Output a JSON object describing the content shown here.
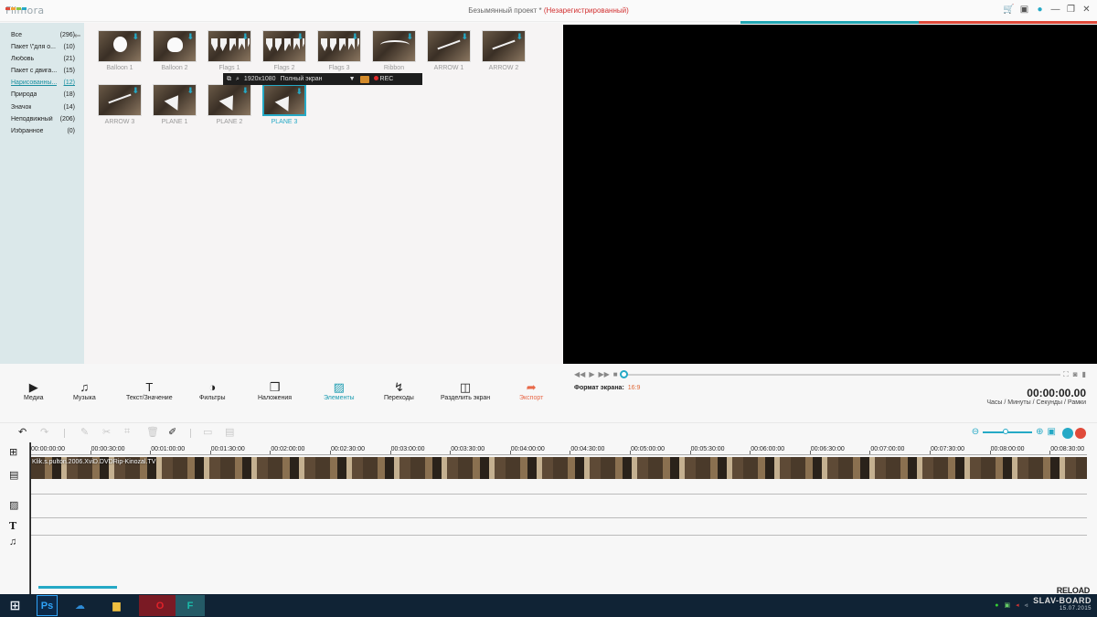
{
  "app": {
    "logo": "Filmora",
    "title": "Безымянный проект *",
    "title_status": "(Незарегистрированный)",
    "brand_colors": [
      "#e04a3a",
      "#f2a33a",
      "#8cc63f",
      "#25a9c6"
    ]
  },
  "title_icons": [
    {
      "name": "cart-icon",
      "glyph": "🛒"
    },
    {
      "name": "save-icon",
      "glyph": "▣"
    },
    {
      "name": "chat-icon",
      "glyph": "●"
    },
    {
      "name": "minimize-icon",
      "glyph": "—"
    },
    {
      "name": "restore-icon",
      "glyph": "❐"
    },
    {
      "name": "close-icon",
      "glyph": "✕"
    }
  ],
  "categories": [
    {
      "label": "Все",
      "count": "(296)"
    },
    {
      "label": "Пакет \\\"для о...",
      "count": "(10)"
    },
    {
      "label": "Любовь",
      "count": "(21)"
    },
    {
      "label": "Пакет с двига...",
      "count": "(15)"
    },
    {
      "label": "Нарисованны...",
      "count": "(12)",
      "active": true
    },
    {
      "label": "Природа",
      "count": "(18)"
    },
    {
      "label": "Значок",
      "count": "(14)"
    },
    {
      "label": "Неподвижный",
      "count": "(206)"
    },
    {
      "label": "Избранное",
      "count": "(0)"
    }
  ],
  "elements": [
    {
      "caption": "Balloon 1",
      "shape": "balloon"
    },
    {
      "caption": "Balloon 2",
      "shape": "heart"
    },
    {
      "caption": "Flags 1",
      "shape": "flags"
    },
    {
      "caption": "Flags 2",
      "shape": "flags"
    },
    {
      "caption": "Flags 3",
      "shape": "flags"
    },
    {
      "caption": "Ribbon",
      "shape": "ribbon"
    },
    {
      "caption": "ARROW 1",
      "shape": "arrow"
    },
    {
      "caption": "ARROW 2",
      "shape": "arrow"
    },
    {
      "caption": "ARROW 3",
      "shape": "arrow"
    },
    {
      "caption": "PLANE 1",
      "shape": "plane"
    },
    {
      "caption": "PLANE 2",
      "shape": "plane"
    },
    {
      "caption": "PLANE 3",
      "shape": "plane",
      "selected": true
    }
  ],
  "recorder": {
    "resolution": "1920x1080",
    "mode": "Полный экран",
    "rec_label": "REC"
  },
  "preview": {
    "format_label": "Формат экрана:",
    "format_value": "16:9",
    "timecode": "00:00:00.00",
    "units": "Часы / Минуты / Секунды / Рамки",
    "progress": 0
  },
  "tabs": [
    {
      "label": "Медиа",
      "icon": "media-icon",
      "glyph": "▶"
    },
    {
      "label": "Музыка",
      "icon": "music-icon",
      "glyph": "♫"
    },
    {
      "label": "Текст/Значение",
      "icon": "text-icon",
      "glyph": "T"
    },
    {
      "label": "Фильтры",
      "icon": "filters-icon",
      "glyph": "◑"
    },
    {
      "label": "Наложения",
      "icon": "overlays-icon",
      "glyph": "❒"
    },
    {
      "label": "Элементы",
      "icon": "elements-icon",
      "glyph": "▨",
      "active": true
    },
    {
      "label": "Переходы",
      "icon": "transitions-icon",
      "glyph": "↯"
    },
    {
      "label": "Разделить экран",
      "icon": "split-screen-icon",
      "glyph": "◫"
    },
    {
      "label": "Экспорт",
      "icon": "export-icon",
      "glyph": "➦",
      "export": true
    }
  ],
  "timeline": {
    "ruler": [
      "00:00:00:00",
      "00:00:30:00",
      "00:01:00:00",
      "00:01:30:00",
      "00:02:00:00",
      "00:02:30:00",
      "00:03:00:00",
      "00:03:30:00",
      "00:04:00:00",
      "00:04:30:00",
      "00:05:00:00",
      "00:05:30:00",
      "00:06:00:00",
      "00:06:30:00",
      "00:07:00:00",
      "00:07:30:00",
      "00:08:00:00",
      "00:08:30:00"
    ],
    "clip_name": "Klik.s.pulton.2006.XviD.DVDRip-Kinozal.TV"
  },
  "taskbar": {
    "apps": [
      {
        "name": "photoshop",
        "label": "Ps",
        "color": "#2fa3f7"
      },
      {
        "name": "onedrive",
        "label": "☁",
        "color": "#2d8bd6"
      },
      {
        "name": "explorer",
        "label": "▆",
        "color": "#f0c040"
      },
      {
        "name": "opera",
        "label": "O",
        "color": "#e0222a"
      },
      {
        "name": "filmora",
        "label": "F",
        "color": "#1abcaa"
      }
    ],
    "brand": "SLAV-BOARD",
    "date": "15.07.2015"
  },
  "watermark": "RELOAD"
}
